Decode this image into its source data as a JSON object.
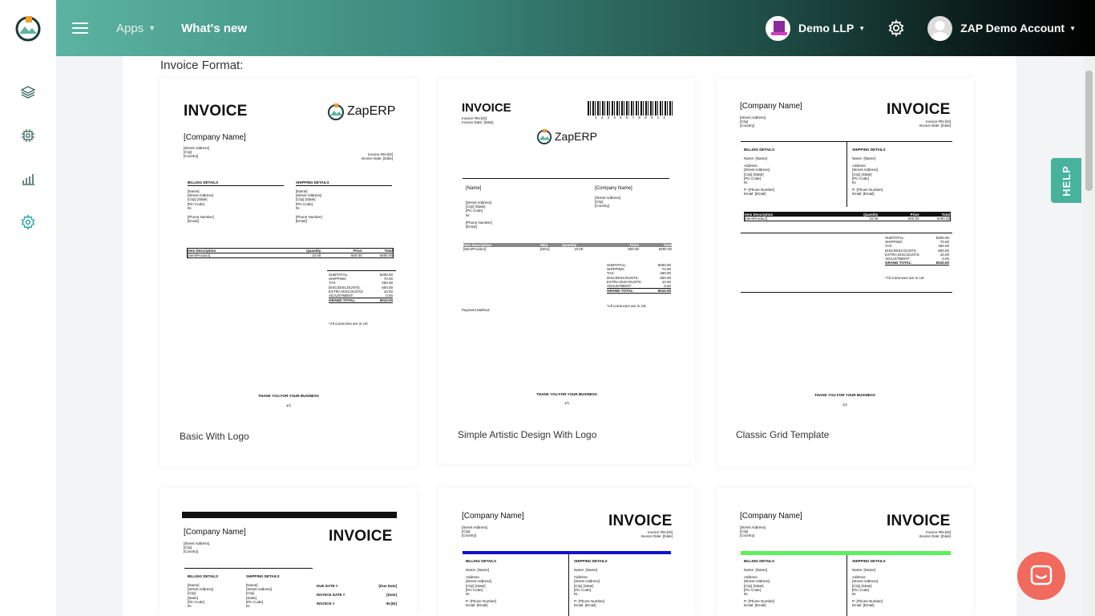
{
  "header": {
    "apps_label": "Apps",
    "whats_new_label": "What's new",
    "company_name": "Demo LLP",
    "account_name": "ZAP Demo Account"
  },
  "help_label": "HELP",
  "page": {
    "section_title": "Invoice Format:"
  },
  "templates": [
    {
      "label": "Basic With Logo"
    },
    {
      "label": "Simple Artistic Design With Logo"
    },
    {
      "label": "Classic Grid Template"
    }
  ],
  "preview": {
    "invoice_word": "INVOICE",
    "company": "[Company Name]",
    "brand": "ZapERP",
    "street": "[Street Address]",
    "city": "[City]",
    "country": "[Country]",
    "city_state": "[City] [State]",
    "state": "[State]",
    "pin": "[Pin Code]",
    "in": "IN",
    "phone": "[Phone Number]",
    "email": "[Email]",
    "name": "[Name]",
    "inv_no": "Invoice #IN-[ID]",
    "inv_date": "Invoice Date: [Date]",
    "billing": "BILLING DETAILS",
    "shipping": "SHIPPING DETAILS",
    "name_field": "Name: [Name]",
    "address_field": "Address:",
    "p_phone": "P: [Phone Number]",
    "email_field": "Email: [Email]",
    "col_item": "Item Description",
    "col_sku": "SKU",
    "col_qty": "Quantity",
    "col_price": "Price",
    "col_total": "Total",
    "row_item": "[Item/Product]",
    "row_sku": "[SKU]",
    "row_qty": "10.00",
    "row_price": "500.00",
    "row_total": "5000.00",
    "subtotal": "SUBTOTAL:",
    "shipping_l": "SHIPPING:",
    "tax": "TAX:",
    "disc": "DISC/DISCOUNTS:",
    "extra": "EXTRA DISCOUNTS:",
    "adjust": "ADJUSTMENT:",
    "grand": "GRAND TOTAL:",
    "v_subtotal": "5000.00",
    "v_shipping": "70.00",
    "v_tax": "450.00",
    "v_disc": "600.00",
    "v_extra": "10.00",
    "v_adjust": "0.00",
    "v_grand": "5010.00",
    "currency_note": "*All currencies are in US",
    "payment": "Payment Method :",
    "thanks": "THANK YOU FOR YOUR BUSINESS",
    "page_no": "1/1",
    "barcode_digits": "1 2 3 4 5 6 7 8 9 0 1 2",
    "due_date": "DUE DATE #",
    "due_date_v": "[Due Date]",
    "inv_date_l": "INVOICE DATE #",
    "inv_date_v": "[Date]",
    "inv_l": "INVOICE #",
    "inv_v": "IN-[ID]"
  },
  "colors": {
    "accent": "#47b39c",
    "chat": "#f06a5d",
    "blue_bar": "#1010d0",
    "green_bar": "#5cf05c"
  }
}
